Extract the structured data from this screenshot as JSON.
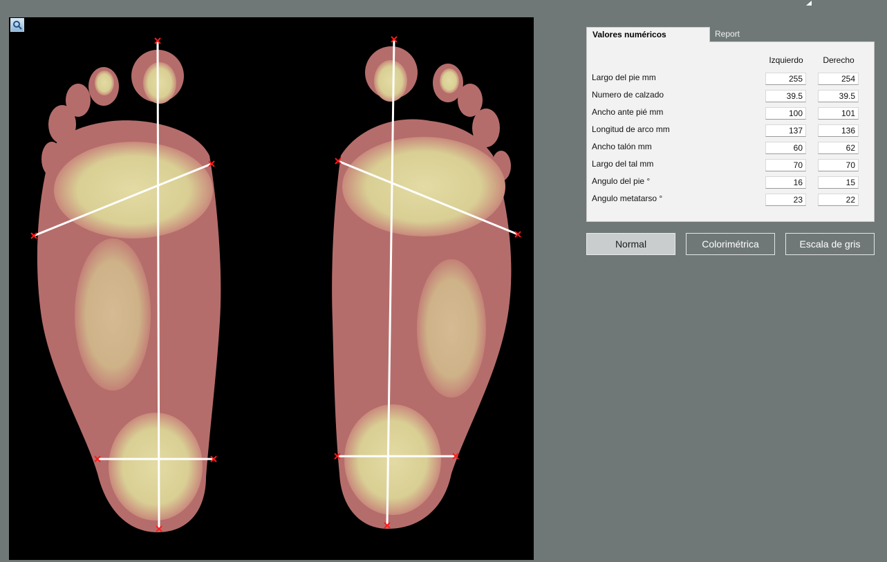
{
  "window": {
    "corner_mark_color": "#ffffff"
  },
  "scan": {
    "zoom_icon": "magnifier-icon",
    "background_color": "#000000",
    "skin_color": "#b66c6a",
    "pressure_color": "#ddd69a",
    "measure_line_color": "#ffffff",
    "marker_color": "#ff1a1a"
  },
  "tabs": [
    {
      "label": "Valores numéricos",
      "active": true
    },
    {
      "label": "Report",
      "active": false
    }
  ],
  "values": {
    "columns": [
      "Izquierdo",
      "Derecho"
    ],
    "rows": [
      {
        "label": "Largo del pie mm",
        "left": "255",
        "right": "254"
      },
      {
        "label": "Numero de calzado",
        "left": "39.5",
        "right": "39.5"
      },
      {
        "label": "Ancho ante pié mm",
        "left": "100",
        "right": "101"
      },
      {
        "label": "Longitud de arco mm",
        "left": "137",
        "right": "136"
      },
      {
        "label": "Ancho talón mm",
        "left": "60",
        "right": "62"
      },
      {
        "label": "Largo del tal mm",
        "left": "70",
        "right": "70"
      },
      {
        "label": "Angulo del pie °",
        "left": "16",
        "right": "15"
      },
      {
        "label": "Angulo metatarso °",
        "left": "23",
        "right": "22"
      }
    ]
  },
  "view_buttons": [
    {
      "label": "Normal",
      "selected": true
    },
    {
      "label": "Colorimétrica",
      "selected": false
    },
    {
      "label": "Escala de gris",
      "selected": false
    }
  ]
}
